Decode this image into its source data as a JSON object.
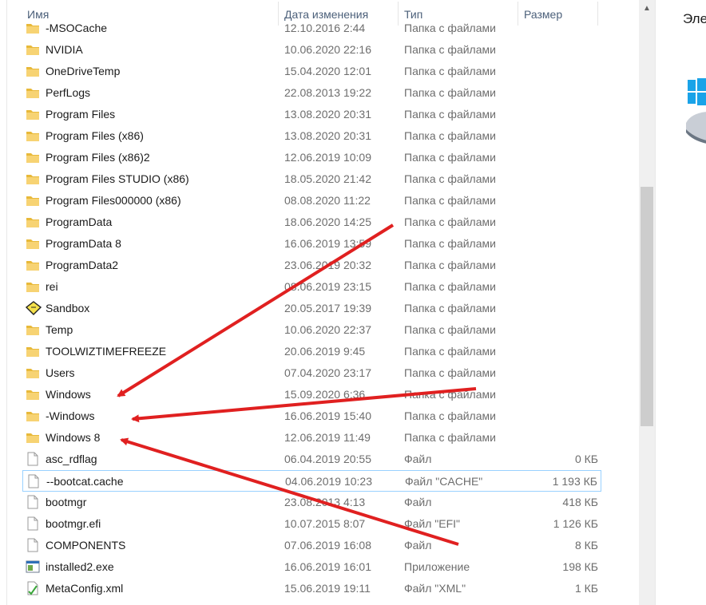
{
  "columns": {
    "name": "Имя",
    "date": "Дата изменения",
    "type": "Тип",
    "size": "Размер"
  },
  "rows": [
    {
      "name": "-MSOCache",
      "date": "12.10.2016 2:44",
      "type": "Папка с файлами",
      "size": "",
      "icon": "folder-icon"
    },
    {
      "name": "NVIDIA",
      "date": "10.06.2020 22:16",
      "type": "Папка с файлами",
      "size": "",
      "icon": "folder-icon"
    },
    {
      "name": "OneDriveTemp",
      "date": "15.04.2020 12:01",
      "type": "Папка с файлами",
      "size": "",
      "icon": "folder-icon"
    },
    {
      "name": "PerfLogs",
      "date": "22.08.2013 19:22",
      "type": "Папка с файлами",
      "size": "",
      "icon": "folder-icon"
    },
    {
      "name": "Program Files",
      "date": "13.08.2020 20:31",
      "type": "Папка с файлами",
      "size": "",
      "icon": "folder-icon"
    },
    {
      "name": "Program Files (x86)",
      "date": "13.08.2020 20:31",
      "type": "Папка с файлами",
      "size": "",
      "icon": "folder-icon"
    },
    {
      "name": "Program Files (x86)2",
      "date": "12.06.2019 10:09",
      "type": "Папка с файлами",
      "size": "",
      "icon": "folder-icon"
    },
    {
      "name": "Program Files STUDIO (x86)",
      "date": "18.05.2020 21:42",
      "type": "Папка с файлами",
      "size": "",
      "icon": "folder-icon"
    },
    {
      "name": "Program Files000000 (x86)",
      "date": "08.08.2020 11:22",
      "type": "Папка с файлами",
      "size": "",
      "icon": "folder-icon"
    },
    {
      "name": "ProgramData",
      "date": "18.06.2020 14:25",
      "type": "Папка с файлами",
      "size": "",
      "icon": "folder-icon"
    },
    {
      "name": "ProgramData 8",
      "date": "16.06.2019 13:59",
      "type": "Папка с файлами",
      "size": "",
      "icon": "folder-icon"
    },
    {
      "name": "ProgramData2",
      "date": "23.06.2019 20:32",
      "type": "Папка с файлами",
      "size": "",
      "icon": "folder-icon"
    },
    {
      "name": "rei",
      "date": "08.06.2019 23:15",
      "type": "Папка с файлами",
      "size": "",
      "icon": "folder-icon"
    },
    {
      "name": "Sandbox",
      "date": "20.05.2017 19:39",
      "type": "Папка с файлами",
      "size": "",
      "icon": "sandbox-icon"
    },
    {
      "name": "Temp",
      "date": "10.06.2020 22:37",
      "type": "Папка с файлами",
      "size": "",
      "icon": "folder-icon"
    },
    {
      "name": "TOOLWIZTIMEFREEZE",
      "date": "20.06.2019 9:45",
      "type": "Папка с файлами",
      "size": "",
      "icon": "folder-icon"
    },
    {
      "name": "Users",
      "date": "07.04.2020 23:17",
      "type": "Папка с файлами",
      "size": "",
      "icon": "folder-icon"
    },
    {
      "name": "Windows",
      "date": "15.09.2020 6:36",
      "type": "Папка с файлами",
      "size": "",
      "icon": "folder-icon"
    },
    {
      "name": "-Windows",
      "date": "16.06.2019 15:40",
      "type": "Папка с файлами",
      "size": "",
      "icon": "folder-icon"
    },
    {
      "name": "Windows 8",
      "date": "12.06.2019 11:49",
      "type": "Папка с файлами",
      "size": "",
      "icon": "folder-icon"
    },
    {
      "name": "asc_rdflag",
      "date": "06.04.2019 20:55",
      "type": "Файл",
      "size": "0 КБ",
      "icon": "file-icon"
    },
    {
      "name": "--bootcat.cache",
      "date": "04.06.2019 10:23",
      "type": "Файл \"CACHE\"",
      "size": "1 193 КБ",
      "icon": "file-icon"
    },
    {
      "name": "bootmgr",
      "date": "23.08.2013 4:13",
      "type": "Файл",
      "size": "418 КБ",
      "icon": "file-icon"
    },
    {
      "name": "bootmgr.efi",
      "date": "10.07.2015 8:07",
      "type": "Файл \"EFI\"",
      "size": "1 126 КБ",
      "icon": "file-icon"
    },
    {
      "name": "COMPONENTS",
      "date": "07.06.2019 16:08",
      "type": "Файл",
      "size": "8 КБ",
      "icon": "file-icon"
    },
    {
      "name": "installed2.exe",
      "date": "16.06.2019 16:01",
      "type": "Приложение",
      "size": "198 КБ",
      "icon": "exe-icon"
    },
    {
      "name": "MetaConfig.xml",
      "date": "15.06.2019 19:11",
      "type": "Файл \"XML\"",
      "size": "1 КБ",
      "icon": "xml-icon"
    }
  ],
  "selected_row": "--bootcat.cache",
  "right_pane": {
    "title": "Эле"
  },
  "colors": {
    "folder": "#e8b93a",
    "selection_border": "#99d1ff",
    "arrow": "#e02020"
  }
}
